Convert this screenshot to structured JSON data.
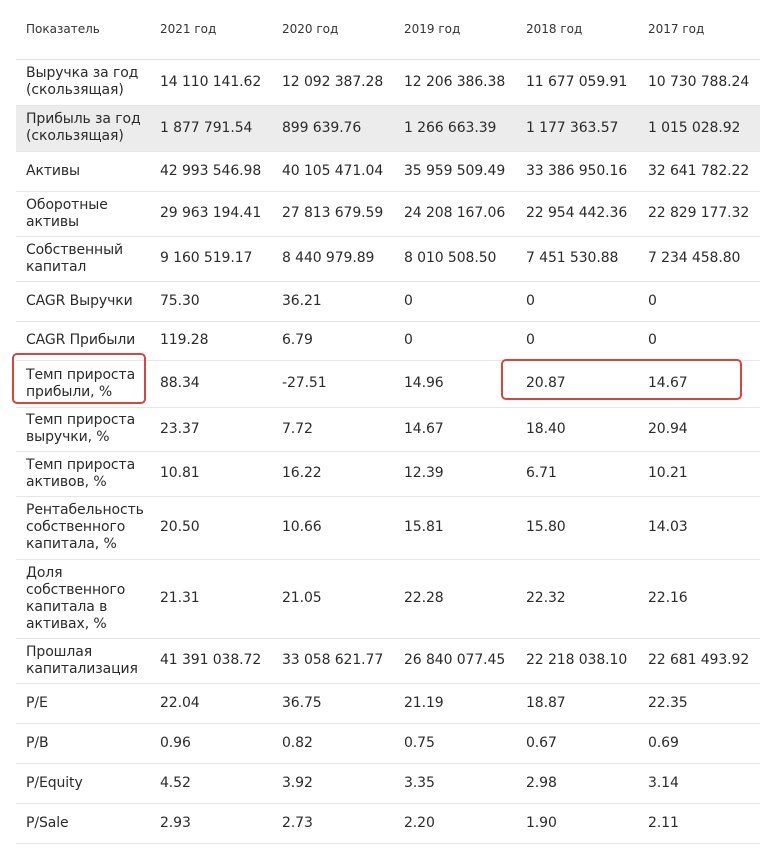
{
  "table": {
    "headers": [
      "Показатель",
      "2021 год",
      "2020 год",
      "2019 год",
      "2018 год",
      "2017 год"
    ],
    "rows": [
      {
        "label": "Выручка за год (скользящая)",
        "values": [
          "14 110 141.62",
          "12 092 387.28",
          "12 206 386.38",
          "11 677 059.91",
          "10 730 788.24"
        ]
      },
      {
        "label": "Прибыль за год (скользящая)",
        "values": [
          "1 877 791.54",
          "899 639.76",
          "1 266 663.39",
          "1 177 363.57",
          "1 015 028.92"
        ]
      },
      {
        "label": "Активы",
        "values": [
          "42 993 546.98",
          "40 105 471.04",
          "35 959 509.49",
          "33 386 950.16",
          "32 641 782.22"
        ]
      },
      {
        "label": "Оборотные активы",
        "values": [
          "29 963 194.41",
          "27 813 679.59",
          "24 208 167.06",
          "22 954 442.36",
          "22 829 177.32"
        ]
      },
      {
        "label": "Собственный капитал",
        "values": [
          "9 160 519.17",
          "8 440 979.89",
          "8 010 508.50",
          "7 451 530.88",
          "7 234 458.80"
        ]
      },
      {
        "label": "CAGR Выручки",
        "values": [
          "75.30",
          "36.21",
          "0",
          "0",
          "0"
        ]
      },
      {
        "label": "CAGR Прибыли",
        "values": [
          "119.28",
          "6.79",
          "0",
          "0",
          "0"
        ]
      },
      {
        "label": "Темп прироста прибыли, %",
        "values": [
          "88.34",
          "-27.51",
          "14.96",
          "20.87",
          "14.67"
        ]
      },
      {
        "label": "Темп прироста выручки, %",
        "values": [
          "23.37",
          "7.72",
          "14.67",
          "18.40",
          "20.94"
        ]
      },
      {
        "label": "Темп прироста активов, %",
        "values": [
          "10.81",
          "16.22",
          "12.39",
          "6.71",
          "10.21"
        ]
      },
      {
        "label": "Рентабельность собственного капитала, %",
        "values": [
          "20.50",
          "10.66",
          "15.81",
          "15.80",
          "14.03"
        ]
      },
      {
        "label": "Доля собственного капитала в активах, %",
        "values": [
          "21.31",
          "21.05",
          "22.28",
          "22.32",
          "22.16"
        ]
      },
      {
        "label": "Прошлая капитализация",
        "values": [
          "41 391 038.72",
          "33 058 621.77",
          "26 840 077.45",
          "22 218 038.10",
          "22 681 493.92"
        ]
      },
      {
        "label": "P/E",
        "values": [
          "22.04",
          "36.75",
          "21.19",
          "18.87",
          "22.35"
        ]
      },
      {
        "label": "P/B",
        "values": [
          "0.96",
          "0.82",
          "0.75",
          "0.67",
          "0.69"
        ]
      },
      {
        "label": "P/Equity",
        "values": [
          "4.52",
          "3.92",
          "3.35",
          "2.98",
          "3.14"
        ]
      },
      {
        "label": "P/Sale",
        "values": [
          "2.93",
          "2.73",
          "2.20",
          "1.90",
          "2.11"
        ]
      }
    ]
  },
  "colors": {
    "highlight": "#d9453b",
    "shaded_row": "#ececec",
    "text": "#2b2b2b"
  }
}
